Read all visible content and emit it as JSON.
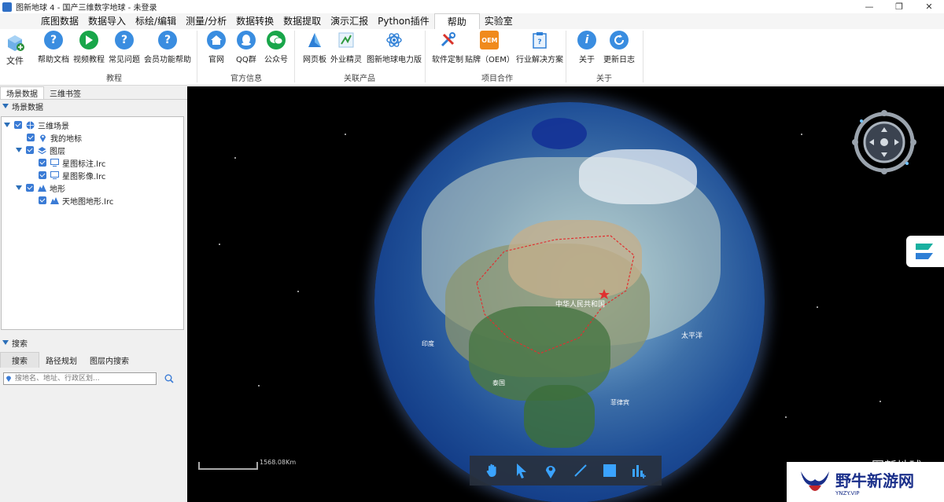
{
  "window": {
    "title": "图新地球 4 - 国产三维数字地球 - 未登录",
    "controls": [
      "minimize",
      "restore",
      "close"
    ]
  },
  "menu": {
    "tabs": [
      "底图数据",
      "数据导入",
      "标绘/编辑",
      "测量/分析",
      "数据转换",
      "数据提取",
      "演示汇报",
      "Python插件",
      "帮助",
      "实验室"
    ],
    "active": "帮助"
  },
  "ribbon": {
    "file_label": "文件",
    "groups": [
      {
        "label": "教程",
        "buttons": [
          "帮助文档",
          "视频教程",
          "常见问题",
          "会员功能帮助"
        ]
      },
      {
        "label": "官方信息",
        "buttons": [
          "官网",
          "QQ群",
          "公众号"
        ]
      },
      {
        "label": "关联产品",
        "buttons": [
          "网页板",
          "外业精灵",
          "图新地球电力版"
        ]
      },
      {
        "label": "项目合作",
        "buttons": [
          "软件定制",
          "贴牌（OEM）",
          "行业解决方案"
        ]
      },
      {
        "label": "关于",
        "buttons": [
          "关于",
          "更新日志"
        ]
      }
    ],
    "oem_badge": "OEM"
  },
  "left_panel": {
    "tabs": [
      "场景数据",
      "三维书签"
    ],
    "scene_header": "场景数据",
    "tree": [
      {
        "label": "三维场景",
        "level": 0,
        "expandable": true,
        "icon": "globe-icon"
      },
      {
        "label": "我的地标",
        "level": 1,
        "expandable": false,
        "icon": "pin-icon"
      },
      {
        "label": "图层",
        "level": 1,
        "expandable": true,
        "icon": "layers-icon"
      },
      {
        "label": "星图标注.lrc",
        "level": 2,
        "expandable": false,
        "icon": "monitor-icon"
      },
      {
        "label": "星图影像.lrc",
        "level": 2,
        "expandable": false,
        "icon": "monitor-icon"
      },
      {
        "label": "地形",
        "level": 1,
        "expandable": true,
        "icon": "terrain-icon"
      },
      {
        "label": "天地图地形.lrc",
        "level": 2,
        "expandable": false,
        "icon": "terrain-icon"
      }
    ],
    "search_header": "搜索",
    "search_tabs": [
      "搜索",
      "路径规划",
      "图层内搜索"
    ],
    "search_placeholder": "搜地名、地址、行政区划..."
  },
  "map": {
    "scale_label": "1568.08Km",
    "watermark": "图新地球",
    "labels": [
      "中华人民共和国",
      "太平洋",
      "菲律宾",
      "印度",
      "泰国"
    ],
    "tools": [
      "hand-icon",
      "pointer-icon",
      "pin-icon",
      "line-icon",
      "square-icon",
      "chart-icon"
    ]
  },
  "watermark_logo": {
    "text": "野牛新游网",
    "url": "YNZY.VIP"
  }
}
